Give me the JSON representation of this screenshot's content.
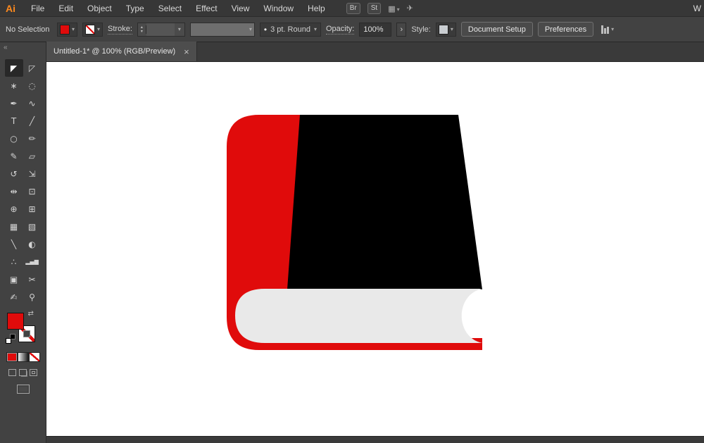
{
  "app": {
    "logo": "Ai"
  },
  "menubar": {
    "menus": [
      "File",
      "Edit",
      "Object",
      "Type",
      "Select",
      "Effect",
      "View",
      "Window",
      "Help"
    ],
    "bridge_label": "Br",
    "stock_label": "St",
    "workspace_cut_label": "W"
  },
  "controlbar": {
    "selection_status": "No Selection",
    "stroke_label": "Stroke:",
    "brush_value": "3 pt. Round",
    "opacity_label": "Opacity:",
    "opacity_value": "100%",
    "style_label": "Style:",
    "document_setup_label": "Document Setup",
    "preferences_label": "Preferences"
  },
  "tab": {
    "title": "Untitled-1* @ 100% (RGB/Preview)",
    "close_glyph": "×"
  },
  "toolbar": {
    "collapse_glyph": "«",
    "swap_glyph": "⇄",
    "tools": [
      {
        "name": "selection",
        "glyph": "◤"
      },
      {
        "name": "direct-selection",
        "glyph": "◸"
      },
      {
        "name": "magic-wand",
        "glyph": "∗"
      },
      {
        "name": "lasso",
        "glyph": "◌"
      },
      {
        "name": "pen",
        "glyph": "✒"
      },
      {
        "name": "curvature",
        "glyph": "∿"
      },
      {
        "name": "type",
        "glyph": "T"
      },
      {
        "name": "line-segment",
        "glyph": "╱"
      },
      {
        "name": "ellipse",
        "glyph": "○"
      },
      {
        "name": "paintbrush",
        "glyph": "✏"
      },
      {
        "name": "pencil",
        "glyph": "✎"
      },
      {
        "name": "eraser",
        "glyph": "▱"
      },
      {
        "name": "rotate",
        "glyph": "↺"
      },
      {
        "name": "scale",
        "glyph": "⇲"
      },
      {
        "name": "width",
        "glyph": "⇹"
      },
      {
        "name": "free-transform",
        "glyph": "⊡"
      },
      {
        "name": "shape-builder",
        "glyph": "⊕"
      },
      {
        "name": "perspective-grid",
        "glyph": "⊞"
      },
      {
        "name": "mesh",
        "glyph": "▦"
      },
      {
        "name": "gradient",
        "glyph": "▧"
      },
      {
        "name": "eyedropper",
        "glyph": "╲"
      },
      {
        "name": "blend",
        "glyph": "◐"
      },
      {
        "name": "symbol-sprayer",
        "glyph": "∴"
      },
      {
        "name": "column-graph",
        "glyph": "▂▄▆"
      },
      {
        "name": "artboard",
        "glyph": "▣"
      },
      {
        "name": "slice",
        "glyph": "✂"
      },
      {
        "name": "hand",
        "glyph": "✍"
      },
      {
        "name": "zoom",
        "glyph": "⚲"
      }
    ]
  },
  "icons": {
    "caret": "▾",
    "up": "▴",
    "down": "▾",
    "chevron_right": "›",
    "dot": "•",
    "arrange": "▦",
    "share": "✈"
  },
  "book": {
    "spine_color": "#e00b0b",
    "cover_color": "#000000",
    "pages_color": "#e9e9e9"
  },
  "colors": {
    "accent_red": "#e00b0b",
    "bar_background": "#424242",
    "canvas_background": "#ffffff"
  }
}
